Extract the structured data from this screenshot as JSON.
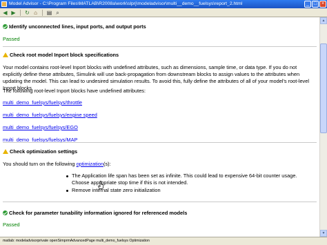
{
  "window": {
    "title": "Model Advisor - C:\\Program Files\\MATLAB\\R2008a\\work\\slprj\\modeladvisor\\multi__demo__fuelsys\\report_2.html"
  },
  "toolbar": {
    "icons": [
      "back-icon",
      "forward-icon",
      "refresh-icon",
      "home-icon",
      "print-icon",
      "find-icon"
    ]
  },
  "checks": [
    {
      "status": "passed",
      "title": "Identify unconnected lines, input ports, and output ports",
      "result": "Passed"
    },
    {
      "status": "warning",
      "title": "Check root model Inport block specifications",
      "description": "Your model contains root-level Inport blocks with undefined attributes, such as dimensions, sample time, or data type. If you do not explicitly define these attributes, Simulink will use back-propagation from downstream blocks to assign values to the attributes when updating the model. This can lead to undesired simulation results. To avoid this, fully define the attributes of all of your model's root-level Inport blocks.",
      "list_intro": "The following root-level Inport blocks have undefined attributes:",
      "links": [
        "multi_demo_fuelsys/fuelsys/throttle",
        "multi_demo_fuelsys/fuelsys/engine speed",
        "multi_demo_fuelsys/fuelsys/EGO",
        "multi_demo_fuelsys/fuelsys/MAP"
      ]
    },
    {
      "status": "warning",
      "title": "Check optimization settings",
      "text_before": "You should turn on the following ",
      "link": "optimization",
      "text_after": "(s):",
      "bullets": [
        "The Application life span has been set as infinite. This could lead to expensive 64-bit counter usage. Choose appropriate stop time if this is not intended.",
        "Remove internal state zero initialization"
      ]
    },
    {
      "status": "passed",
      "title": "Check for parameter tunability information ignored for referenced models",
      "result": "Passed"
    }
  ],
  "status_bar": {
    "text": "matlab: modeladvisorprivate openSimprmAdvancedPage multi_demo_fuelsys Optimization"
  },
  "colors": {
    "passed": "#008000",
    "link": "#0000ee",
    "warning_icon": "#e8b400",
    "titlebar": "#1b54c4"
  }
}
